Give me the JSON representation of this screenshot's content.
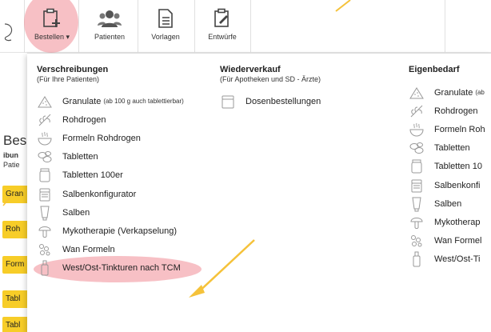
{
  "toolbar": {
    "buttons": [
      {
        "label": "Bestellen",
        "caret": "▾",
        "icon": "clipboard-plus-icon",
        "active": true
      },
      {
        "label": "Patienten",
        "icon": "users-icon"
      },
      {
        "label": "Vorlagen",
        "icon": "document-icon"
      },
      {
        "label": "Entwürfe",
        "icon": "clipboard-edit-icon"
      }
    ]
  },
  "background": {
    "title": "Bes",
    "line1": "ibun",
    "line2": "Patie",
    "buttons": [
      "Gran",
      "Roh",
      "Form",
      "Tabl",
      "Tabl"
    ]
  },
  "menu": {
    "columns": [
      {
        "title": "Verschreibungen",
        "subtitle": "(Für Ihre Patienten)",
        "items": [
          {
            "label": "Granulate",
            "note": "(ab 100 g auch tablettierbar)",
            "icon": "granules-icon"
          },
          {
            "label": "Rohdrogen",
            "icon": "herb-icon"
          },
          {
            "label": "Formeln Rohdrogen",
            "icon": "bowl-icon"
          },
          {
            "label": "Tabletten",
            "icon": "tablets-icon"
          },
          {
            "label": "Tabletten 100er",
            "icon": "jar-icon"
          },
          {
            "label": "Salbenkonfigurator",
            "icon": "ointment-jar-icon"
          },
          {
            "label": "Salben",
            "icon": "tube-icon"
          },
          {
            "label": "Mykotherapie (Verkapselung)",
            "icon": "mushroom-icon"
          },
          {
            "label": "Wan Formeln",
            "icon": "pills-icon"
          },
          {
            "label": "West/Ost-Tinkturen nach TCM",
            "icon": "tincture-icon",
            "highlight": true
          }
        ]
      },
      {
        "title": "Wiederverkauf",
        "subtitle": "(Für Apotheken und SD - Ärzte)",
        "items": [
          {
            "label": "Dosenbestellungen",
            "icon": "can-icon"
          }
        ]
      },
      {
        "title": "Eigenbedarf",
        "subtitle": "",
        "items": [
          {
            "label": "Granulate",
            "note": "(ab",
            "icon": "granules-icon"
          },
          {
            "label": "Rohdrogen",
            "icon": "herb-icon"
          },
          {
            "label": "Formeln Roh",
            "icon": "bowl-icon"
          },
          {
            "label": "Tabletten",
            "icon": "tablets-icon"
          },
          {
            "label": "Tabletten 10",
            "icon": "jar-icon"
          },
          {
            "label": "Salbenkonfi",
            "icon": "ointment-jar-icon"
          },
          {
            "label": "Salben",
            "icon": "tube-icon"
          },
          {
            "label": "Mykotherap",
            "icon": "mushroom-icon"
          },
          {
            "label": "Wan Formel",
            "icon": "pills-icon"
          },
          {
            "label": "West/Ost-Ti",
            "icon": "tincture-icon"
          }
        ]
      }
    ]
  },
  "colors": {
    "highlight": "#f08c96",
    "arrow": "#f5c23a",
    "accent_button": "#f7cd28"
  }
}
